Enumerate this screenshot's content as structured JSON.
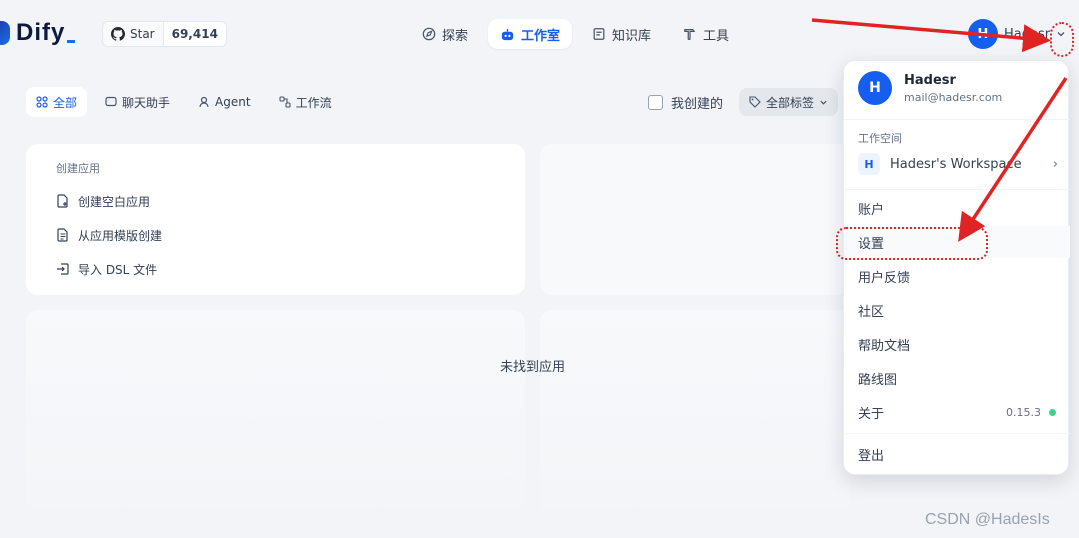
{
  "brand": {
    "name": "Dify"
  },
  "github": {
    "star_label": "Star",
    "star_count": "69,414"
  },
  "nav": {
    "items": [
      {
        "label": "探索",
        "icon": "compass-icon"
      },
      {
        "label": "工作室",
        "icon": "robot-icon"
      },
      {
        "label": "知识库",
        "icon": "book-icon"
      },
      {
        "label": "工具",
        "icon": "hammer-icon"
      }
    ],
    "active": "工作室"
  },
  "user": {
    "initial": "H",
    "name": "Hadesr",
    "email": "mail@hadesr.com"
  },
  "filters": {
    "tabs": [
      {
        "label": "全部"
      },
      {
        "label": "聊天助手"
      },
      {
        "label": "Agent"
      },
      {
        "label": "工作流"
      }
    ],
    "mine_label": "我创建的",
    "tags_label": "全部标签"
  },
  "create_card": {
    "title": "创建应用",
    "items": [
      "创建空白应用",
      "从应用模版创建",
      "导入 DSL 文件"
    ]
  },
  "empty_text": "未找到应用",
  "dropdown": {
    "workspace_label": "工作空间",
    "workspace_initial": "H",
    "workspace_name": "Hadesr's Workspace",
    "items": [
      "账户",
      "设置",
      "用户反馈",
      "社区",
      "帮助文档",
      "路线图",
      "关于",
      "登出"
    ],
    "version": "0.15.3",
    "version_dot_color": "#47cd89"
  },
  "annotation_color": "#e02424",
  "watermark": "CSDN @HadesIs"
}
